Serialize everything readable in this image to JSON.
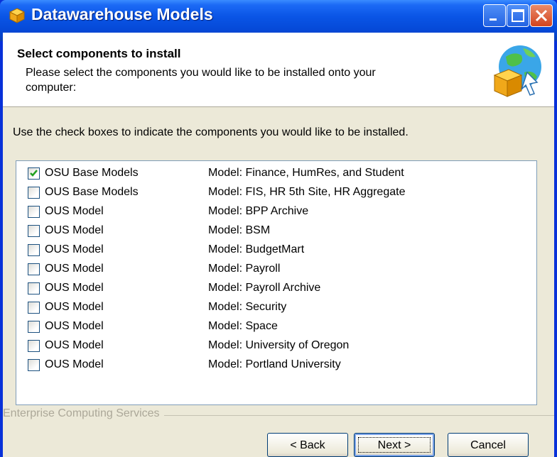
{
  "window": {
    "title": "Datawarehouse Models"
  },
  "header": {
    "title": "Select components to install",
    "subtitle": "Please select the components you would like to be installed onto your computer:"
  },
  "instructions": "Use the check boxes to indicate the components you would like to be installed.",
  "components": [
    {
      "name": "OSU Base Models",
      "description": "Model: Finance, HumRes, and Student",
      "checked": true
    },
    {
      "name": "OUS Base Models",
      "description": "Model: FIS, HR 5th Site, HR Aggregate",
      "checked": false
    },
    {
      "name": "OUS Model",
      "description": "Model: BPP Archive",
      "checked": false
    },
    {
      "name": "OUS Model",
      "description": "Model: BSM",
      "checked": false
    },
    {
      "name": "OUS Model",
      "description": "Model: BudgetMart",
      "checked": false
    },
    {
      "name": "OUS Model",
      "description": "Model: Payroll",
      "checked": false
    },
    {
      "name": "OUS Model",
      "description": "Model: Payroll Archive",
      "checked": false
    },
    {
      "name": "OUS Model",
      "description": "Model: Security",
      "checked": false
    },
    {
      "name": "OUS Model",
      "description": "Model: Space",
      "checked": false
    },
    {
      "name": "OUS Model",
      "description": "Model: University of Oregon",
      "checked": false
    },
    {
      "name": "OUS Model",
      "description": "Model: Portland University",
      "checked": false
    }
  ],
  "branding": "Enterprise Computing Services",
  "buttons": {
    "back": "< Back",
    "next": "Next >",
    "cancel": "Cancel"
  },
  "icons": {
    "app": "package-icon",
    "minimize": "minimize-icon",
    "maximize": "maximize-icon",
    "close": "close-icon",
    "header": "install-globe-icon",
    "check": "checkmark-icon"
  },
  "colors": {
    "titlebar": "#0a55e6",
    "dialog_bg": "#ece9d8",
    "close_button": "#d4441e",
    "check": "#21a121"
  }
}
